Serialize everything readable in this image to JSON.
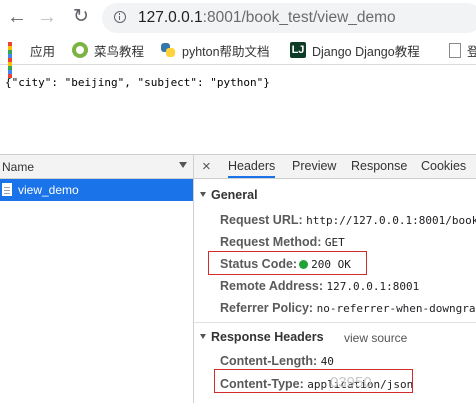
{
  "address_bar": {
    "url_host": "127.0.0.1",
    "url_rest": ":8001/book_test/view_demo"
  },
  "bookmarks": [
    {
      "label": "应用",
      "icon": "apps-icon"
    },
    {
      "label": "菜鸟教程",
      "icon": "runoob-icon"
    },
    {
      "label": "pyhton帮助文档",
      "icon": "python-icon"
    },
    {
      "label": "Django Django教程",
      "icon": "django-icon"
    },
    {
      "label": "登",
      "icon": "page-icon"
    }
  ],
  "page": {
    "json_text": "{\"city\": \"beijing\", \"subject\": \"python\"}"
  },
  "devtools": {
    "list_header": "Name",
    "request_name": "view_demo",
    "tabs": [
      "Headers",
      "Preview",
      "Response",
      "Cookies"
    ],
    "close_symbol": "×",
    "general": {
      "title": "General",
      "rows": [
        {
          "key": "Request URL:",
          "value": "http://127.0.0.1:8001/book_"
        },
        {
          "key": "Request Method:",
          "value": "GET"
        },
        {
          "key": "Status Code:",
          "value": "200 OK"
        },
        {
          "key": "Remote Address:",
          "value": "127.0.0.1:8001"
        },
        {
          "key": "Referrer Policy:",
          "value": "no-referrer-when-downgrad"
        }
      ]
    },
    "response_headers": {
      "title": "Response Headers",
      "view_source": "view source",
      "rows": [
        {
          "key": "Content-Length:",
          "value": "40"
        },
        {
          "key": "Content-Type:",
          "value": "application/json"
        }
      ]
    },
    "status_color": "#21a336",
    "highlight_color": "#d12b2b"
  },
  "watermark": "03950"
}
